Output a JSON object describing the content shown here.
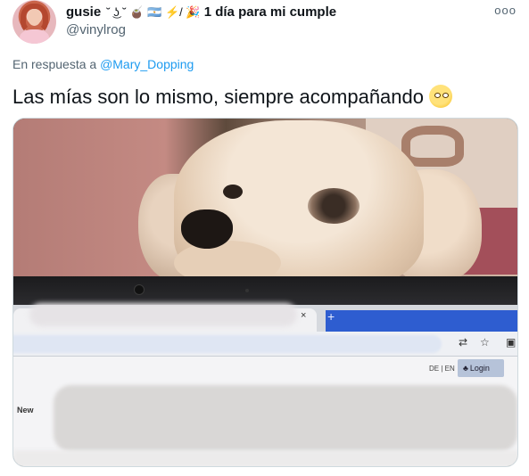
{
  "author": {
    "display_name": "gusie",
    "name_decorations": "˘ ͜ʖ ˘ 🧉 🇦🇷 ⚡/ 🎉",
    "status": "1 día para mi cumple",
    "handle": "@vinylrog"
  },
  "more_label": "ooo",
  "reply": {
    "prefix": "En respuesta a",
    "mention": "@Mary_Dopping"
  },
  "tweet_text": "Las mías son lo mismo, siempre acompañando",
  "screen": {
    "tab_close": "×",
    "new_tab": "+",
    "lang_switch": "DE | EN",
    "login_label": "Login",
    "news_label": "New"
  },
  "icons": [
    "avatar",
    "more-icon",
    "face-with-rolling-eyes-emoji",
    "tab-close-icon",
    "new-tab-icon",
    "translate-icon",
    "star-icon",
    "extensions-icon",
    "user-icon"
  ]
}
